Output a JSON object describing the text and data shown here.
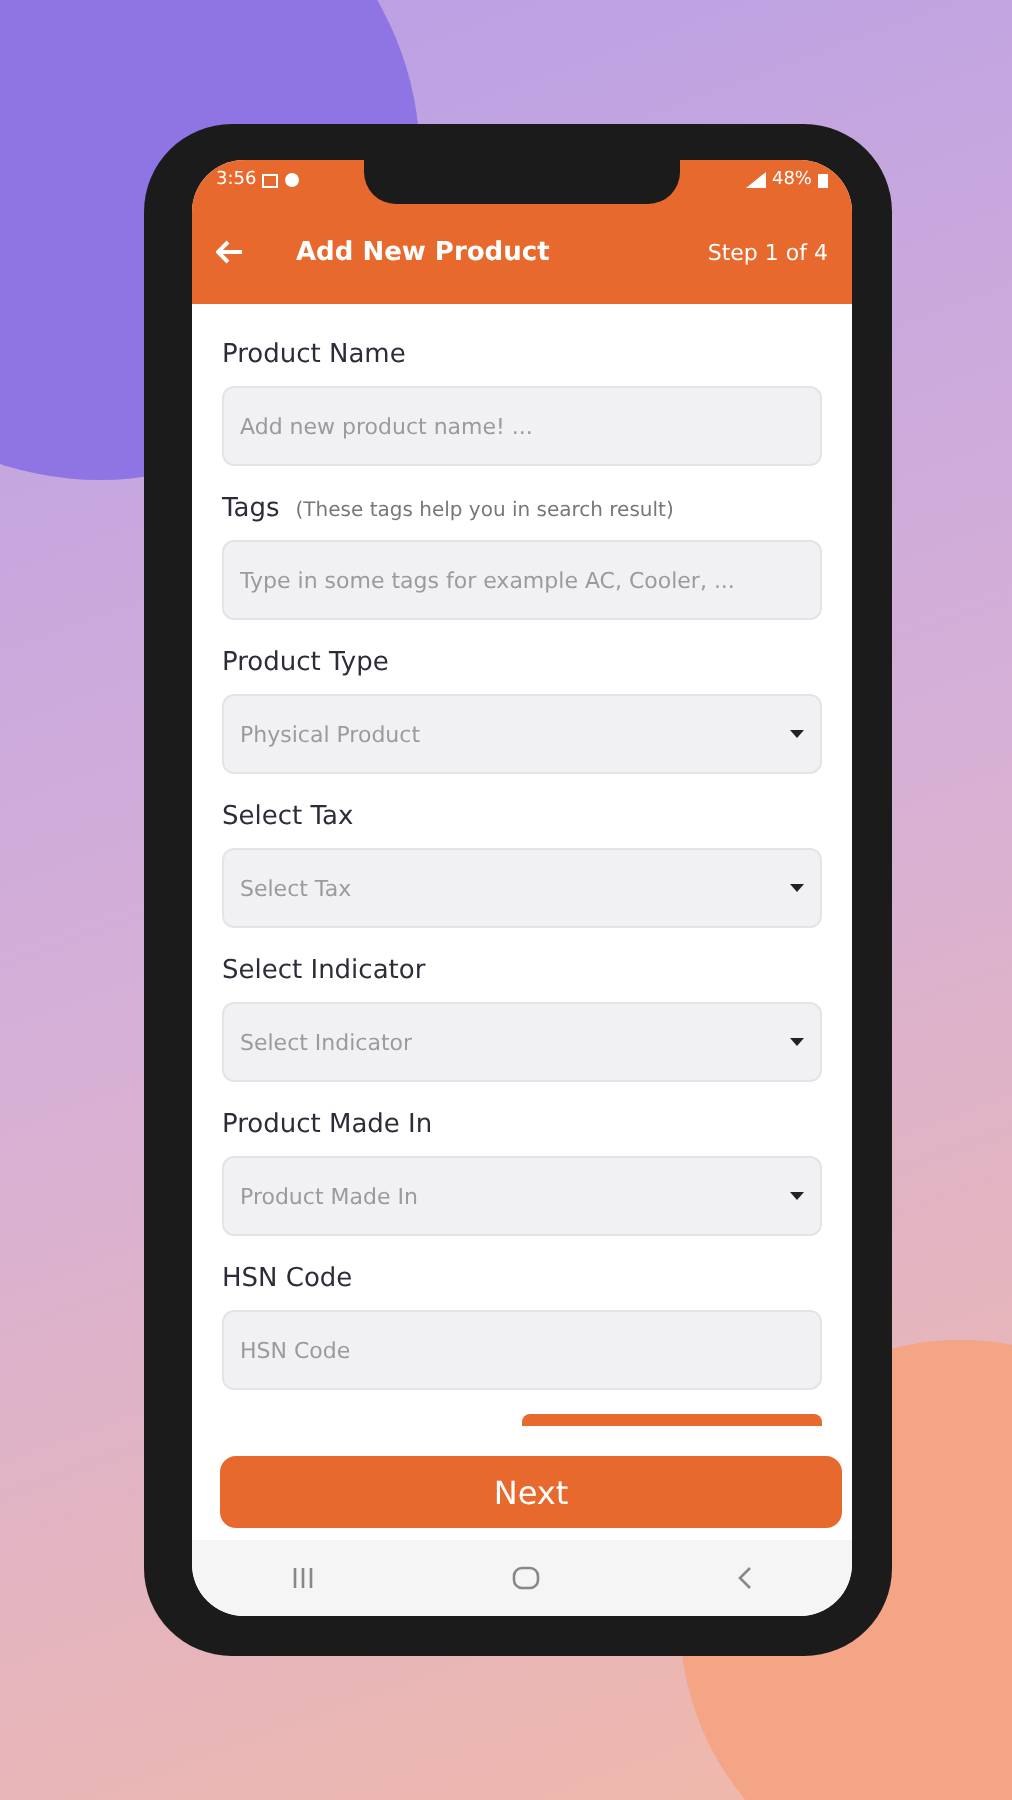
{
  "status_bar": {
    "time": "3:56",
    "battery": "48%"
  },
  "app_bar": {
    "title": "Add New Product",
    "step": "Step 1 of 4"
  },
  "fields": [
    {
      "kind": "text",
      "label": "Product Name",
      "placeholder": "Add new product name! ..."
    },
    {
      "kind": "text",
      "label": "Tags",
      "hint": "(These tags help you in search result)",
      "placeholder": "Type in some tags for example AC, Cooler, ..."
    },
    {
      "kind": "dropdown",
      "label": "Product Type",
      "value": "Physical Product"
    },
    {
      "kind": "dropdown",
      "label": "Select Tax",
      "value": "Select Tax"
    },
    {
      "kind": "dropdown",
      "label": "Select Indicator",
      "value": "Select Indicator"
    },
    {
      "kind": "dropdown",
      "label": "Product Made In",
      "value": "Product Made In"
    },
    {
      "kind": "text",
      "label": "HSN Code",
      "placeholder": "HSN Code"
    }
  ],
  "next_button": "Next"
}
